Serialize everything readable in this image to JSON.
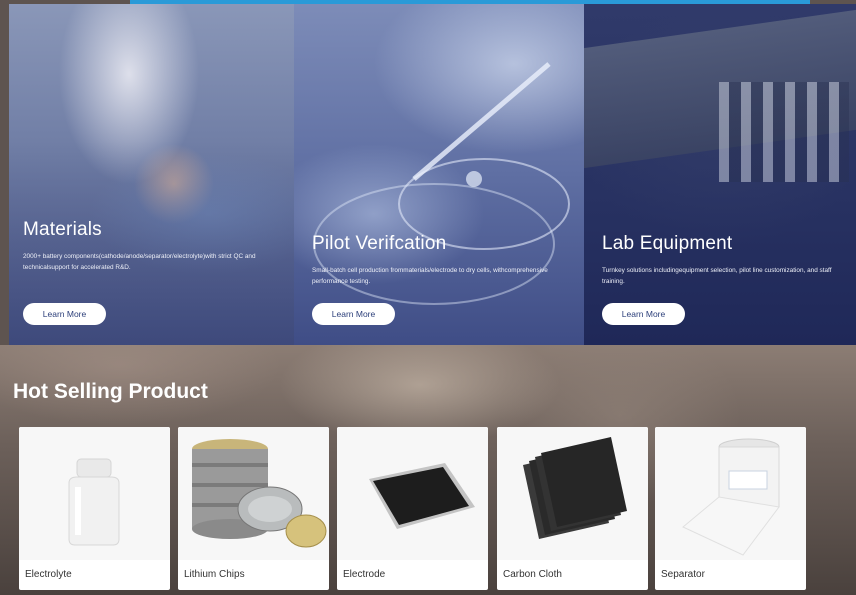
{
  "panels": [
    {
      "title": "Materials",
      "text": "2000+ battery components(cathode/anode/separator/electrolyte)with strict QC and technicalsupport for accelerated R&D.",
      "button": "Learn More"
    },
    {
      "title": "Pilot Verifcation",
      "text": "Small-batch cell production frommaterials/electrode to dry cells, withcomprehensive performance testing.",
      "button": "Learn More"
    },
    {
      "title": "Lab Equipment",
      "text": "Turnkey solutions includingequipment selection, pilot line customization, and staff training.",
      "button": "Learn More"
    }
  ],
  "hot_selling": {
    "title": "Hot Selling Product",
    "products": [
      {
        "name": "Electrolyte",
        "icon": "electrolyte-bottle"
      },
      {
        "name": "Lithium Chips",
        "icon": "lithium-chips-can"
      },
      {
        "name": "Electrode",
        "icon": "electrode-sheet"
      },
      {
        "name": "Carbon Cloth",
        "icon": "carbon-cloth-stack"
      },
      {
        "name": "Separator",
        "icon": "separator-roll"
      }
    ]
  },
  "colors": {
    "accent_line": "#2a9ad8",
    "button_text": "#2c3f7a"
  }
}
